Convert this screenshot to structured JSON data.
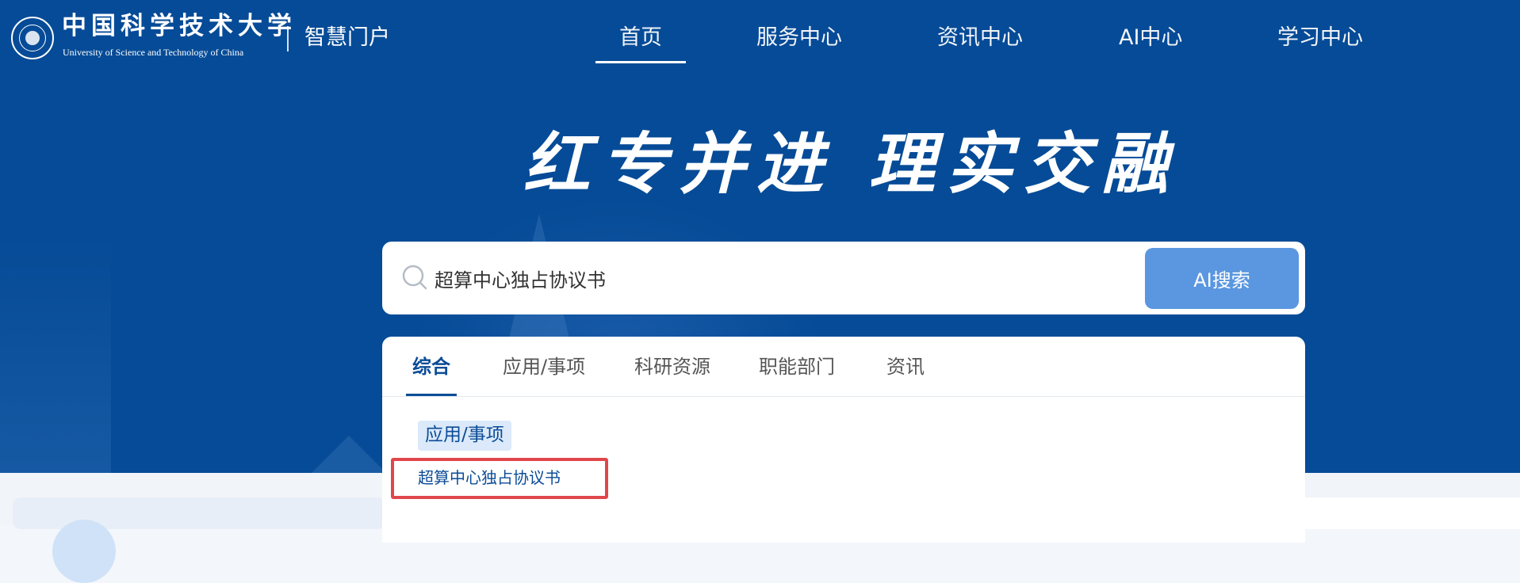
{
  "header": {
    "logo_cn": "中国科学技术大学",
    "logo_en": "University of Science and Technology of China",
    "portal_name": "智慧门户",
    "nav": {
      "home": "首页",
      "service": "服务中心",
      "news": "资讯中心",
      "ai": "AI中心",
      "study": "学习中心"
    },
    "active_nav": "首页"
  },
  "hero": {
    "slogan": "红专并进 理实交融"
  },
  "search": {
    "value": "超算中心独占协议书",
    "button_label": "AI搜索",
    "icon": "search-icon"
  },
  "results": {
    "tabs": {
      "all": "综合",
      "apps": "应用/事项",
      "research": "科研资源",
      "dept": "职能部门",
      "news": "资讯"
    },
    "active_tab": "综合",
    "category": "应用/事项",
    "items": [
      "超算中心独占协议书"
    ]
  },
  "colors": {
    "hero_bg": "#064b97",
    "accent": "#0b4c96",
    "button": "#5a97e0",
    "highlight": "#e0474b"
  }
}
